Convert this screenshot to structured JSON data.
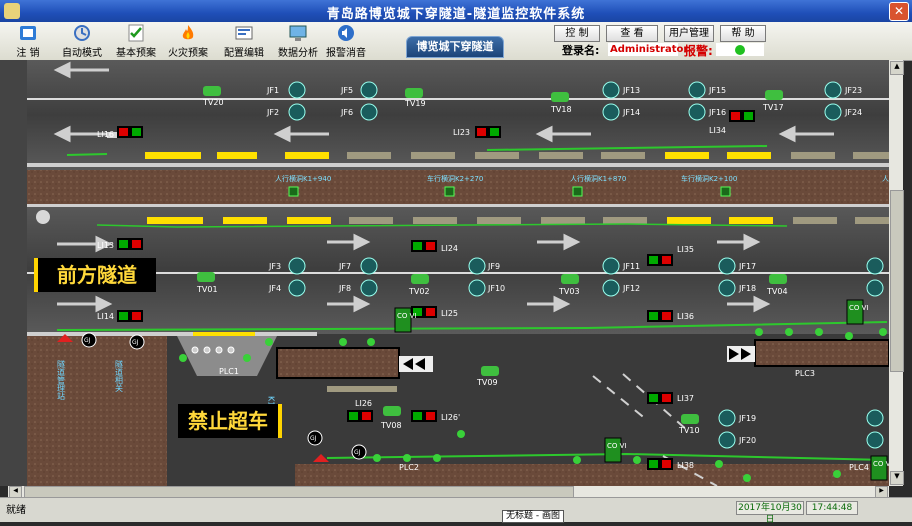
{
  "window": {
    "title": "青岛路博览城下穿隧道-隧道监控软件系统",
    "close_glyph": "✕"
  },
  "toolbar": {
    "items": [
      {
        "label": "注 销",
        "icon": "logout-icon"
      },
      {
        "label": "自动模式",
        "icon": "auto-mode-icon"
      },
      {
        "label": "基本预案",
        "icon": "checklist-icon"
      },
      {
        "label": "火灾预案",
        "icon": "fire-icon"
      },
      {
        "label": "配置编辑",
        "icon": "config-edit-icon"
      },
      {
        "label": "数据分析",
        "icon": "data-analysis-icon"
      },
      {
        "label": "报警消音",
        "icon": "speaker-icon"
      }
    ]
  },
  "tab": {
    "label": "博览城下穿隧道"
  },
  "top_buttons": {
    "control": "控 制",
    "view": "查 看",
    "user_mgmt": "用户管理",
    "help": "帮 助"
  },
  "login": {
    "label": "登录名:",
    "user": "Administrator",
    "alarm_label": "报警:"
  },
  "signs": {
    "tunnel_ahead": "前方隧道",
    "no_overtaking": "禁止超车"
  },
  "crosswalks": [
    {
      "label": "人行横洞K1+940"
    },
    {
      "label": "车行横洞K2+270"
    },
    {
      "label": "人行横洞K1+870"
    },
    {
      "label": "车行横洞K2+100"
    },
    {
      "label": "人"
    }
  ],
  "fans": [
    "JF1",
    "JF2",
    "JF5",
    "JF6",
    "JF13",
    "JF14",
    "JF15",
    "JF16",
    "JF23",
    "JF24",
    "JF3",
    "JF4",
    "JF7",
    "JF8",
    "JF9",
    "JF10",
    "JF11",
    "JF12",
    "JF17",
    "JF18",
    "JF19",
    "JF20"
  ],
  "cams": [
    "TV20",
    "TV19",
    "TV18",
    "TV17",
    "TV01",
    "TV02",
    "TV03",
    "TV04",
    "TV09",
    "TV08",
    "TV10"
  ],
  "lane_indicators": [
    "LI16",
    "LI23",
    "LI34",
    "LI13",
    "LI24",
    "LI35",
    "LI14",
    "LI25",
    "LI36",
    "LI26",
    "LI26'",
    "LI37",
    "LI38"
  ],
  "plc": [
    "PLC1",
    "PLC2",
    "PLC3",
    "PLC4"
  ],
  "covi": "CO VI",
  "gj": "GJ",
  "side_text": [
    "隧道管理站",
    "隧道相关",
    "K1+940"
  ],
  "status": {
    "left": "就绪",
    "date": "2017年10月30日",
    "time": "17:44:48"
  },
  "taskbar": {
    "label": "无标题 - 画图"
  },
  "colors": {
    "road": "#3a3a3a",
    "ground": "#6a4a3a",
    "signal_green": "#20c020",
    "signal_red": "#e02020",
    "sign_text": "#ffd83a"
  }
}
